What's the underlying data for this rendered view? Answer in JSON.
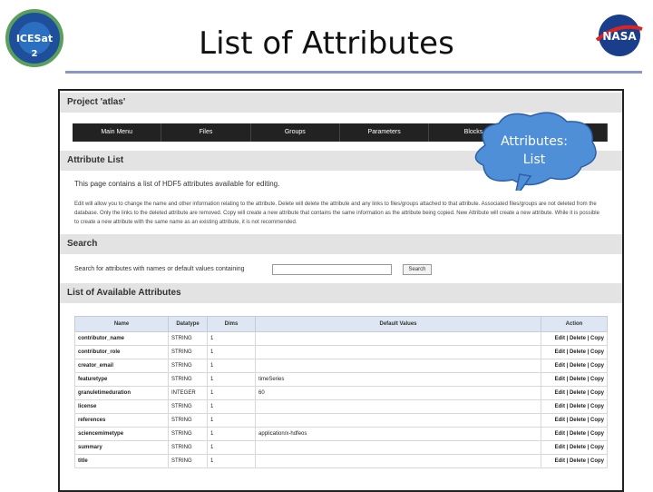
{
  "slide": {
    "title": "List of Attributes",
    "left_logo_text": "ICESat 2",
    "right_logo_text": "NASA"
  },
  "project": {
    "header": "Project 'atlas'"
  },
  "menu": {
    "items": [
      "Main Menu",
      "Files",
      "Groups",
      "Parameters",
      "Blocks",
      ""
    ]
  },
  "attribute_list": {
    "header": "Attribute List",
    "description": "This page contains a list of HDF5 attributes available for editing.",
    "help": "Edit will allow you to change the name and other information relating to the attribute. Delete will delete the attribute and any links to files/groups attached to that attribute. Associated files/groups are not deleted from the database. Only the links to the deleted attribute are removed. Copy will create a new attribute that contains the same information as the attribute being copied. New Attribute will create a new attribute. While it is possible to create a new attribute with the same name as an existing attribute, it is not recommended."
  },
  "search": {
    "header": "Search",
    "label": "Search for attributes with names or default values containing",
    "button": "Search"
  },
  "available": {
    "header": "List of Available Attributes",
    "columns": [
      "Name",
      "Datatype",
      "Dims",
      "Default Values",
      "Action"
    ],
    "rows": [
      {
        "name": "contributor_name",
        "datatype": "STRING",
        "dims": "1",
        "default": "",
        "action": "Edit | Delete | Copy"
      },
      {
        "name": "contributor_role",
        "datatype": "STRING",
        "dims": "1",
        "default": "",
        "action": "Edit | Delete | Copy"
      },
      {
        "name": "creator_email",
        "datatype": "STRING",
        "dims": "1",
        "default": "",
        "action": "Edit | Delete | Copy"
      },
      {
        "name": "featuretype",
        "datatype": "STRING",
        "dims": "1",
        "default": "timeSeries",
        "action": "Edit | Delete | Copy"
      },
      {
        "name": "granuletimeduration",
        "datatype": "INTEGER",
        "dims": "1",
        "default": "60",
        "action": "Edit | Delete | Copy"
      },
      {
        "name": "license",
        "datatype": "STRING",
        "dims": "1",
        "default": "",
        "action": "Edit | Delete | Copy"
      },
      {
        "name": "references",
        "datatype": "STRING",
        "dims": "1",
        "default": "",
        "action": "Edit | Delete | Copy"
      },
      {
        "name": "sciencemimetype",
        "datatype": "STRING",
        "dims": "1",
        "default": "application/x-hdfeos",
        "action": "Edit | Delete | Copy"
      },
      {
        "name": "summary",
        "datatype": "STRING",
        "dims": "1",
        "default": "",
        "action": "Edit | Delete | Copy"
      },
      {
        "name": "title",
        "datatype": "STRING",
        "dims": "1",
        "default": "",
        "action": "Edit | Delete | Copy"
      }
    ]
  },
  "callout": {
    "line1": "Attributes:",
    "line2": "List"
  },
  "colors": {
    "callout": "#4f8fd8",
    "title_rule": "#8b96c8",
    "link": "#1b3f9c"
  }
}
